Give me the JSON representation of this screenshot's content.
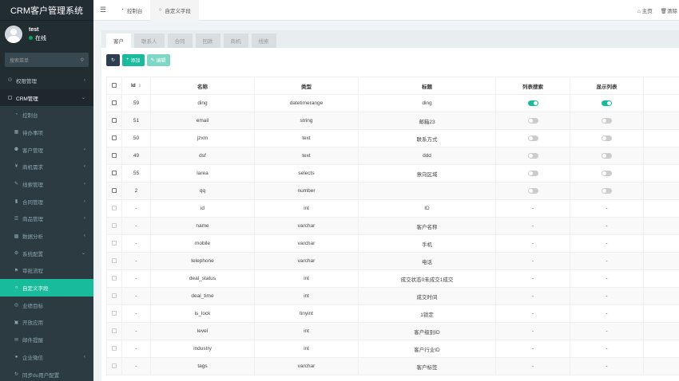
{
  "app": {
    "title": "CRM客户管理系统"
  },
  "user": {
    "name": "test",
    "status": "在线"
  },
  "search": {
    "placeholder": "搜索菜单"
  },
  "menu": [
    {
      "label": "权限管理",
      "icon": "group-icon",
      "type": "top",
      "expandable": true
    },
    {
      "label": "CRM管理",
      "icon": "cube-icon",
      "type": "open",
      "expandable": true
    },
    {
      "label": "控制台",
      "icon": "dashboard-icon",
      "type": "sub"
    },
    {
      "label": "待办事项",
      "icon": "calendar-icon",
      "type": "sub"
    },
    {
      "label": "客户管理",
      "icon": "users-icon",
      "type": "sub",
      "expandable": true
    },
    {
      "label": "商机需求",
      "icon": "yen-icon",
      "type": "sub",
      "expandable": true
    },
    {
      "label": "线索管理",
      "icon": "pen-icon",
      "type": "sub",
      "expandable": true
    },
    {
      "label": "合同管理",
      "icon": "bookmark-icon",
      "type": "sub",
      "expandable": true
    },
    {
      "label": "商品管理",
      "icon": "list-icon",
      "type": "sub",
      "expandable": true
    },
    {
      "label": "数据分析",
      "icon": "chart-icon",
      "type": "sub",
      "expandable": true
    },
    {
      "label": "系统配置",
      "icon": "cogs-icon",
      "type": "subopen",
      "expandable": true
    },
    {
      "label": "审批流程",
      "icon": "flag-icon",
      "type": "sub"
    },
    {
      "label": "自定义字段",
      "icon": "circle-icon",
      "type": "active"
    },
    {
      "label": "业绩目标",
      "icon": "target-icon",
      "type": "sub"
    },
    {
      "label": "开放应用",
      "icon": "cubes-icon",
      "type": "sub"
    },
    {
      "label": "邮件提醒",
      "icon": "mail-icon",
      "type": "sub"
    },
    {
      "label": "企业微信",
      "icon": "wechat-icon",
      "type": "sub",
      "expandable": true
    },
    {
      "label": "同步du用户配置",
      "icon": "sync-icon",
      "type": "sub"
    }
  ],
  "topbar": {
    "tabs": [
      {
        "label": "控制台",
        "icon": "dashboard-icon",
        "active": false
      },
      {
        "label": "自定义字段",
        "icon": "circle-icon",
        "active": true
      }
    ],
    "home_label": "主页",
    "clear_label": "清除"
  },
  "content_tabs": [
    "客户",
    "联系人",
    "合同",
    "回款",
    "商机",
    "线索"
  ],
  "toolbar": {
    "add_label": "添加",
    "edit_label": "编辑"
  },
  "table": {
    "headers": [
      "Id",
      "名称",
      "类型",
      "标题",
      "列表搜索",
      "显示列表"
    ],
    "rows": [
      {
        "id": "59",
        "name": "ding",
        "type": "datetimerange",
        "title": "ding",
        "search": "on",
        "show": "on",
        "editable": true
      },
      {
        "id": "51",
        "name": "email",
        "type": "string",
        "title": "邮箱23",
        "search": "off",
        "show": "off",
        "editable": true
      },
      {
        "id": "50",
        "name": "jzxm",
        "type": "text",
        "title": "联系方式",
        "search": "off",
        "show": "off",
        "editable": true
      },
      {
        "id": "49",
        "name": "dsf",
        "type": "text",
        "title": "ddd",
        "search": "off",
        "show": "off",
        "editable": true
      },
      {
        "id": "55",
        "name": "larea",
        "type": "selects",
        "title": "意向区域",
        "search": "off",
        "show": "off",
        "editable": true
      },
      {
        "id": "2",
        "name": "qq",
        "type": "number",
        "title": "",
        "search": "off",
        "show": "off",
        "editable": true
      },
      {
        "id": "-",
        "name": "id",
        "type": "int",
        "title": "ID",
        "search": "-",
        "show": "-",
        "editable": false
      },
      {
        "id": "-",
        "name": "name",
        "type": "varchar",
        "title": "客户名称",
        "search": "-",
        "show": "-",
        "editable": false
      },
      {
        "id": "-",
        "name": "mobile",
        "type": "varchar",
        "title": "手机",
        "search": "-",
        "show": "-",
        "editable": false
      },
      {
        "id": "-",
        "name": "telephone",
        "type": "varchar",
        "title": "电话",
        "search": "-",
        "show": "-",
        "editable": false
      },
      {
        "id": "-",
        "name": "deal_status",
        "type": "int",
        "title": "成交状态0未成交1成交",
        "search": "-",
        "show": "-",
        "editable": false
      },
      {
        "id": "-",
        "name": "deal_time",
        "type": "int",
        "title": "成交时间",
        "search": "-",
        "show": "-",
        "editable": false
      },
      {
        "id": "-",
        "name": "is_lock",
        "type": "tinyint",
        "title": "1锁定",
        "search": "-",
        "show": "-",
        "editable": false
      },
      {
        "id": "-",
        "name": "level",
        "type": "int",
        "title": "客户级别ID",
        "search": "-",
        "show": "-",
        "editable": false
      },
      {
        "id": "-",
        "name": "industry",
        "type": "int",
        "title": "客户行业ID",
        "search": "-",
        "show": "-",
        "editable": false
      },
      {
        "id": "-",
        "name": "tags",
        "type": "varchar",
        "title": "客户标签",
        "search": "-",
        "show": "-",
        "editable": false
      }
    ]
  }
}
